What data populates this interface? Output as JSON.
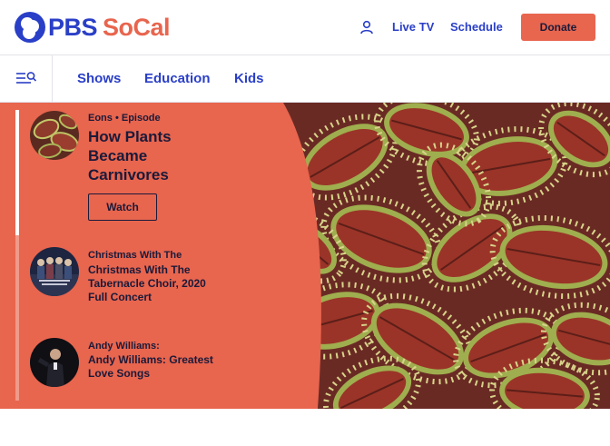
{
  "brand": {
    "name_part1": "PBS",
    "name_part2": "SoCal"
  },
  "header": {
    "live_tv": "Live TV",
    "schedule": "Schedule",
    "donate": "Donate"
  },
  "nav": {
    "links": [
      "Shows",
      "Education",
      "Kids"
    ]
  },
  "hero": {
    "progress": 0.43,
    "items": [
      {
        "eyebrow": "Eons • Episode",
        "title": "How Plants Became Carnivores",
        "button": "Watch",
        "active": true
      },
      {
        "eyebrow": "Christmas With The",
        "title": "Christmas With The Tabernacle Choir, 2020 Full Concert",
        "active": false
      },
      {
        "eyebrow": "Andy Williams:",
        "title": "Andy Williams: Greatest Love Songs",
        "active": false
      }
    ]
  },
  "colors": {
    "brand_blue": "#2a3fc7",
    "accent_orange": "#e8654e",
    "text_dark": "#1a1a3a"
  }
}
